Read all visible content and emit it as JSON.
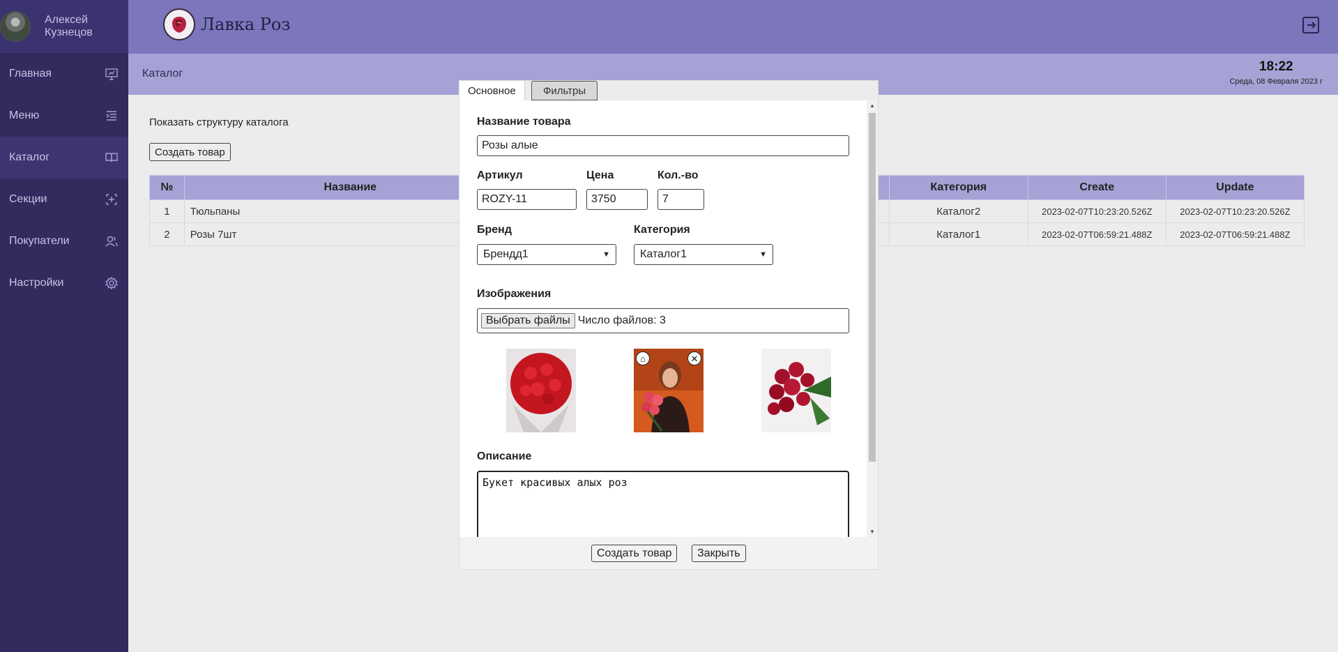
{
  "user": {
    "name_line1": "Алексей",
    "name_line2": "Кузнецов"
  },
  "sidebar": {
    "items": [
      {
        "label": "Главная",
        "icon": "presentation-icon"
      },
      {
        "label": "Меню",
        "icon": "menu-indent-icon"
      },
      {
        "label": "Каталог",
        "icon": "book-icon",
        "active": true
      },
      {
        "label": "Секции",
        "icon": "sections-icon"
      },
      {
        "label": "Покупатели",
        "icon": "users-icon"
      },
      {
        "label": "Настройки",
        "icon": "gear-icon"
      }
    ]
  },
  "header": {
    "brand": "Лавка Роз"
  },
  "subheader": {
    "breadcrumb": "Каталог",
    "time": "18:22",
    "date": "Среда, 08 Февраля 2023 г"
  },
  "main": {
    "show_structure": "Показать структуру каталога",
    "create_button": "Создать товар",
    "table": {
      "headers": {
        "num": "№",
        "name": "Название",
        "category": "Категория",
        "create": "Create",
        "update": "Update"
      },
      "rows": [
        {
          "num": "1",
          "name": "Тюльпаны",
          "category": "Каталог2",
          "create": "2023-02-07T10:23:20.526Z",
          "update": "2023-02-07T10:23:20.526Z"
        },
        {
          "num": "2",
          "name": "Розы 7шт",
          "category": "Каталог1",
          "create": "2023-02-07T06:59:21.488Z",
          "update": "2023-02-07T06:59:21.488Z"
        }
      ]
    }
  },
  "modal": {
    "tabs": {
      "main": "Основное",
      "filters": "Фильтры"
    },
    "name_label": "Название товара",
    "name_value": "Розы алые",
    "sku_label": "Артикул",
    "sku_value": "ROZY-11",
    "price_label": "Цена",
    "price_value": "3750",
    "qty_label": "Кол.-во",
    "qty_value": "7",
    "brand_label": "Бренд",
    "brand_value": "Брендд1",
    "category_label": "Категория",
    "category_value": "Каталог1",
    "images_label": "Изображения",
    "file_button": "Выбрать файлы",
    "file_count": "Число файлов: 3",
    "description_label": "Описание",
    "description_value": "Букет красивых алых роз",
    "submit_button": "Создать товар",
    "close_button": "Закрыть"
  },
  "colors": {
    "sidebar_bg": "#332a5e",
    "header_bg": "#7c76bd",
    "subheader_bg": "#a6a2d6",
    "table_header_bg": "#a6a2d6"
  }
}
